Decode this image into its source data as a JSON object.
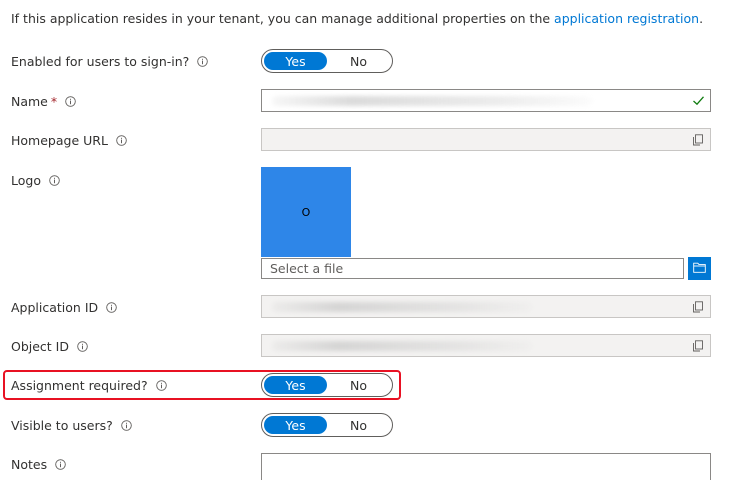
{
  "intro": {
    "text": "If this application resides in your tenant, you can manage additional properties on the ",
    "link": "application registration",
    "suffix": "."
  },
  "enabled_signin": {
    "label": "Enabled for users to sign-in?",
    "yes": "Yes",
    "no": "No",
    "value": "Yes"
  },
  "name": {
    "label": "Name",
    "required_mark": "*"
  },
  "homepage_url": {
    "label": "Homepage URL"
  },
  "logo": {
    "label": "Logo",
    "preview_text": "O",
    "file_placeholder": "Select a file"
  },
  "application_id": {
    "label": "Application ID"
  },
  "object_id": {
    "label": "Object ID"
  },
  "assignment_required": {
    "label": "Assignment required?",
    "yes": "Yes",
    "no": "No",
    "value": "Yes",
    "highlight_color": "#e81123"
  },
  "visible_to_users": {
    "label": "Visible to users?",
    "yes": "Yes",
    "no": "No",
    "value": "Yes"
  },
  "notes": {
    "label": "Notes"
  },
  "colors": {
    "accent": "#0078d4",
    "link": "#0078d4",
    "valid_check": "#107c10",
    "required": "#a4262c",
    "logo_bg": "#2e86e8"
  },
  "icons": [
    "info-icon",
    "check-icon",
    "copy-icon",
    "folder-icon"
  ]
}
